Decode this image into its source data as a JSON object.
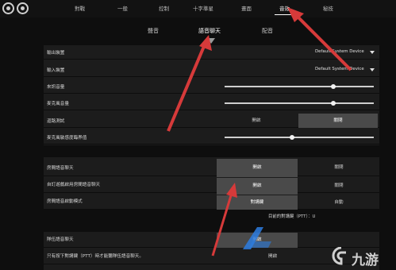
{
  "top_tabs": [
    "對戰",
    "一般",
    "控制",
    "十字準星",
    "畫面",
    "音效",
    "秘技"
  ],
  "active_top_tab": "音效",
  "sub_tabs": [
    "聲音",
    "語音聊天",
    "配音"
  ],
  "active_sub_tab": "語音聊天",
  "devices": {
    "output_label": "輸出裝置",
    "output_value": "Default System Device",
    "input_label": "輸入裝置",
    "input_value": "Default System Device"
  },
  "sliders": {
    "incoming_label": "來訊音量",
    "incoming_level": 0.73,
    "mic_label": "麥克風音量",
    "mic_level": 0.73,
    "mic_threshold_label": "麥克風敏感度臨界值",
    "mic_threshold_level": 0.45
  },
  "loopback": {
    "label": "迴路測試",
    "off": "開啟",
    "on": "關閉",
    "selected": "關閉"
  },
  "party": {
    "party_voice_label": "房間語音聊天",
    "party_voice_on": "開啟",
    "party_voice_off": "關閉",
    "auto_join_label": "自訂遊戲啟用房間語音聊天",
    "auto_join_on": "開啟",
    "auto_join_off": "關閉",
    "activation_label": "房間語音啟動模式",
    "activation_ptt": "對講鍵",
    "activation_auto": "自動",
    "ptt_binding_text": "目前的對講鍵（PTT）：U"
  },
  "team": {
    "team_voice_label": "隊伍語音聊天",
    "team_voice_on": "開啟",
    "ptt_only_label": "只有按下對講鍵（PTT）時才能聽隊伍語音聊天。",
    "partial_text": "開啟"
  },
  "watermark": {
    "brand": "九游",
    "colors": {
      "arrow": "#d63a3a",
      "logo_blue": "#2d7de0",
      "logo_text": "#cfcfcf"
    }
  }
}
